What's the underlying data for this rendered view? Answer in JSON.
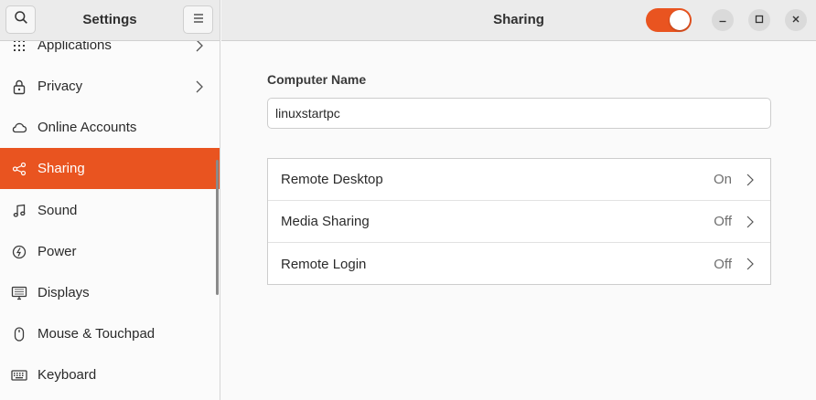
{
  "sidebar": {
    "title": "Settings",
    "items": [
      {
        "label": "Applications",
        "icon": "apps-grid-icon",
        "has_chevron": true
      },
      {
        "label": "Privacy",
        "icon": "lock-icon",
        "has_chevron": true
      },
      {
        "label": "Online Accounts",
        "icon": "cloud-icon",
        "has_chevron": false
      },
      {
        "label": "Sharing",
        "icon": "share-icon",
        "has_chevron": false,
        "active": true
      },
      {
        "label": "Sound",
        "icon": "music-note-icon",
        "has_chevron": false
      },
      {
        "label": "Power",
        "icon": "power-icon",
        "has_chevron": false
      },
      {
        "label": "Displays",
        "icon": "display-icon",
        "has_chevron": false
      },
      {
        "label": "Mouse & Touchpad",
        "icon": "mouse-icon",
        "has_chevron": false
      },
      {
        "label": "Keyboard",
        "icon": "keyboard-icon",
        "has_chevron": false
      }
    ]
  },
  "header": {
    "title": "Sharing",
    "sharing_enabled": true
  },
  "computer_name": {
    "label": "Computer Name",
    "value": "linuxstartpc"
  },
  "services": [
    {
      "label": "Remote Desktop",
      "status": "On"
    },
    {
      "label": "Media Sharing",
      "status": "Off"
    },
    {
      "label": "Remote Login",
      "status": "Off"
    }
  ],
  "colors": {
    "accent": "#e95420",
    "header_bg": "#ebebeb",
    "content_bg": "#fafafa"
  }
}
